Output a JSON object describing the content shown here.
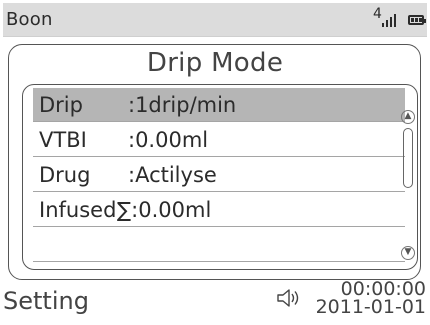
{
  "status_bar": {
    "title": "Boon",
    "signal_level": "4",
    "signal_bars": 4,
    "battery_cells": 3
  },
  "panel": {
    "title": "Drip Mode",
    "rows": [
      {
        "name": "Drip",
        "value": ":1drip/min",
        "selected": true
      },
      {
        "name": "VTBI",
        "value": ":0.00ml",
        "selected": false
      },
      {
        "name": "Drug",
        "value": ":Actilyse",
        "selected": false
      },
      {
        "name": "Infused",
        "value": "∑:0.00ml",
        "selected": false
      },
      {
        "name": "",
        "value": "",
        "selected": false
      }
    ]
  },
  "footer": {
    "setting_label": "Setting",
    "time": "00:00:00",
    "date": "2011-01-01",
    "volume_icon": "speaker-icon"
  },
  "colors": {
    "status_bar_bg": "#dcdcdc",
    "selected_row_bg": "#b5b5b5",
    "text": "#2b2b2b"
  }
}
